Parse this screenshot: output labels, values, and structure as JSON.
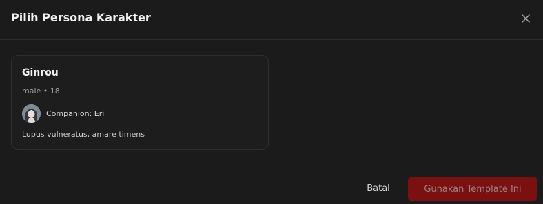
{
  "dialog": {
    "title": "Pilih Persona Karakter",
    "close_icon": "close-icon"
  },
  "personas": [
    {
      "name": "Ginrou",
      "meta": "male • 18",
      "companion_label": "Companion: Eri",
      "description": "Lupus vulneratus, amare timens"
    }
  ],
  "footer": {
    "cancel_label": "Batal",
    "confirm_label": "Gunakan Template Ini"
  },
  "colors": {
    "background": "#1b1b1b",
    "primary_button": "#7a1010",
    "border": "#2c2c2c"
  }
}
